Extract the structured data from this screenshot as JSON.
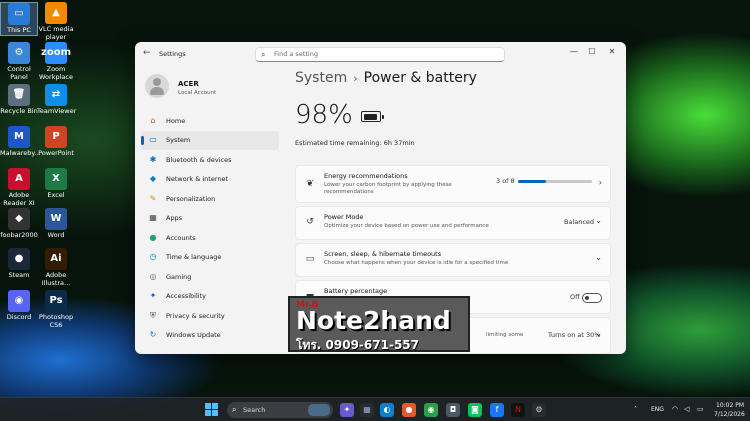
{
  "desktop": {
    "icons": [
      {
        "label": "This PC",
        "glyph": "▭",
        "color": "#2b7bd6"
      },
      {
        "label": "VLC media player",
        "glyph": "▲",
        "color": "#f08a00"
      },
      {
        "label": "Control Panel",
        "glyph": "⚙",
        "color": "#3a87d9"
      },
      {
        "label": "Zoom Workplace",
        "glyph": "zoom",
        "color": "#2d8cff"
      },
      {
        "label": "Recycle Bin",
        "glyph": "🗑",
        "color": "#5c7080"
      },
      {
        "label": "TeamViewer",
        "glyph": "⇄",
        "color": "#0e8ee9"
      },
      {
        "label": "Malwareby...",
        "glyph": "M",
        "color": "#1e56c8"
      },
      {
        "label": "PowerPoint",
        "glyph": "P",
        "color": "#d04423"
      },
      {
        "label": "Adobe Reader XI",
        "glyph": "A",
        "color": "#c8102e"
      },
      {
        "label": "Excel",
        "glyph": "X",
        "color": "#1d7a45"
      },
      {
        "label": "foobar2000",
        "glyph": "◆",
        "color": "#333333"
      },
      {
        "label": "Word",
        "glyph": "W",
        "color": "#2b5797"
      },
      {
        "label": "Steam",
        "glyph": "●",
        "color": "#1b2838"
      },
      {
        "label": "Adobe Illustra...",
        "glyph": "Ai",
        "color": "#331c00"
      },
      {
        "label": "Discord",
        "glyph": "◉",
        "color": "#5865f2"
      },
      {
        "label": "Photoshop CS6",
        "glyph": "Ps",
        "color": "#0a2b4a"
      }
    ]
  },
  "window": {
    "app_title": "Settings",
    "search_placeholder": "Find a setting",
    "controls": {
      "minimize": "—",
      "maximize": "☐",
      "close": "✕"
    }
  },
  "account": {
    "name": "ACER",
    "type": "Local Account"
  },
  "nav": [
    {
      "label": "Home",
      "icon": "⌂",
      "color": "#d35400",
      "active": false
    },
    {
      "label": "System",
      "icon": "▭",
      "color": "#0067c0",
      "active": true
    },
    {
      "label": "Bluetooth & devices",
      "icon": "✱",
      "color": "#0067c0",
      "active": false
    },
    {
      "label": "Network & internet",
      "icon": "◆",
      "color": "#0078d4",
      "active": false
    },
    {
      "label": "Personalization",
      "icon": "✎",
      "color": "#e08a00",
      "active": false
    },
    {
      "label": "Apps",
      "icon": "▦",
      "color": "#444444",
      "active": false
    },
    {
      "label": "Accounts",
      "icon": "●",
      "color": "#1aa37a",
      "active": false
    },
    {
      "label": "Time & language",
      "icon": "◷",
      "color": "#0078d4",
      "active": false
    },
    {
      "label": "Gaming",
      "icon": "◎",
      "color": "#666666",
      "active": false
    },
    {
      "label": "Accessibility",
      "icon": "✦",
      "color": "#0067c0",
      "active": false
    },
    {
      "label": "Privacy & security",
      "icon": "⛨",
      "color": "#555555",
      "active": false
    },
    {
      "label": "Windows Update",
      "icon": "↻",
      "color": "#0078d4",
      "active": false
    }
  ],
  "content": {
    "crumb_parent": "System",
    "crumb_current": "Power & battery",
    "battery_percent": "98%",
    "battery_level": 0.98,
    "estimated": "Estimated time remaining: 6h 37min",
    "cards": {
      "energy": {
        "title": "Energy recommendations",
        "desc": "Lower your carbon footprint by applying these recommendations",
        "value": "3 of 8",
        "progress": 0.375
      },
      "power_mode": {
        "title": "Power Mode",
        "desc": "Optimize your device based on power use and performance",
        "value": "Balanced"
      },
      "screen_sleep": {
        "title": "Screen, sleep, & hibernate timeouts",
        "desc": "Choose what happens when your device is idle for a specified time"
      },
      "battery_pct": {
        "title": "Battery percentage",
        "desc": "Display battery percentage on taskbar",
        "value": "Off"
      },
      "saver": {
        "desc_tail": "limiting some",
        "value": "Turns on at 30%"
      }
    }
  },
  "watermark": {
    "top": "Mr.B",
    "main": "Note2hand",
    "phone": "โทร. 0909-671-557"
  },
  "taskbar": {
    "search_label": "Search",
    "lang": "ENG",
    "time": "10:02 PM",
    "date": "7/12/2026"
  }
}
